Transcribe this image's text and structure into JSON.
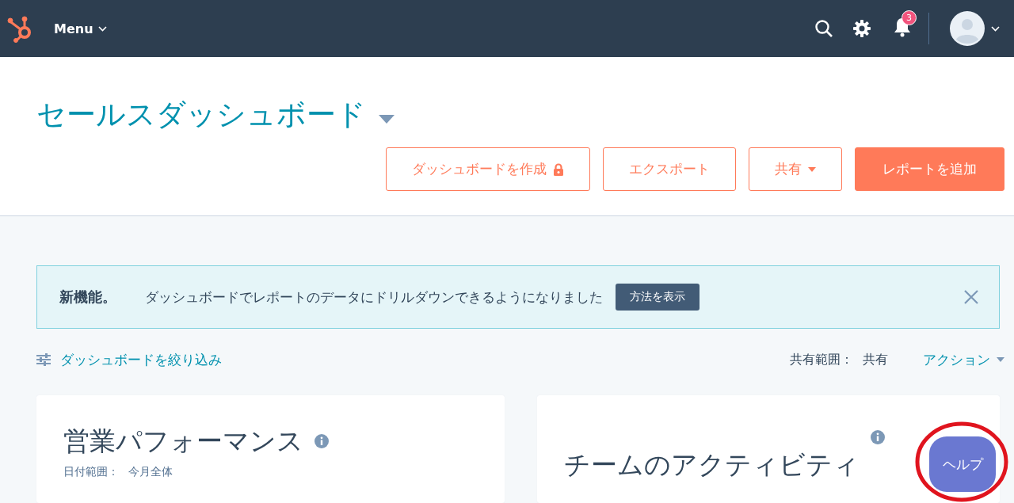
{
  "header": {
    "menu_label": "Menu",
    "notification_count": "3"
  },
  "dashboard": {
    "title": "セールスダッシュボード",
    "buttons": [
      {
        "label": "ダッシュボードを作成",
        "kind": "locked"
      },
      {
        "label": "エクスポート",
        "kind": "plain"
      },
      {
        "label": "共有",
        "kind": "dropdown"
      },
      {
        "label": "レポートを追加",
        "kind": "primary"
      }
    ]
  },
  "banner": {
    "heading": "新機能。",
    "message": "ダッシュボードでレポートのデータにドリルダウンできるようになりました",
    "button": "方法を表示"
  },
  "toolbar": {
    "filter_label": "ダッシュボードを絞り込み",
    "sharing_label": "共有範囲：",
    "sharing_value": "共有",
    "actions": "アクション"
  },
  "cards": [
    {
      "title": "営業パフォーマンス",
      "date_label": "日付範囲：",
      "date_value": "今月全体"
    },
    {
      "title": "チームのアクティビティ"
    }
  ],
  "help_button": "ヘルプ"
}
